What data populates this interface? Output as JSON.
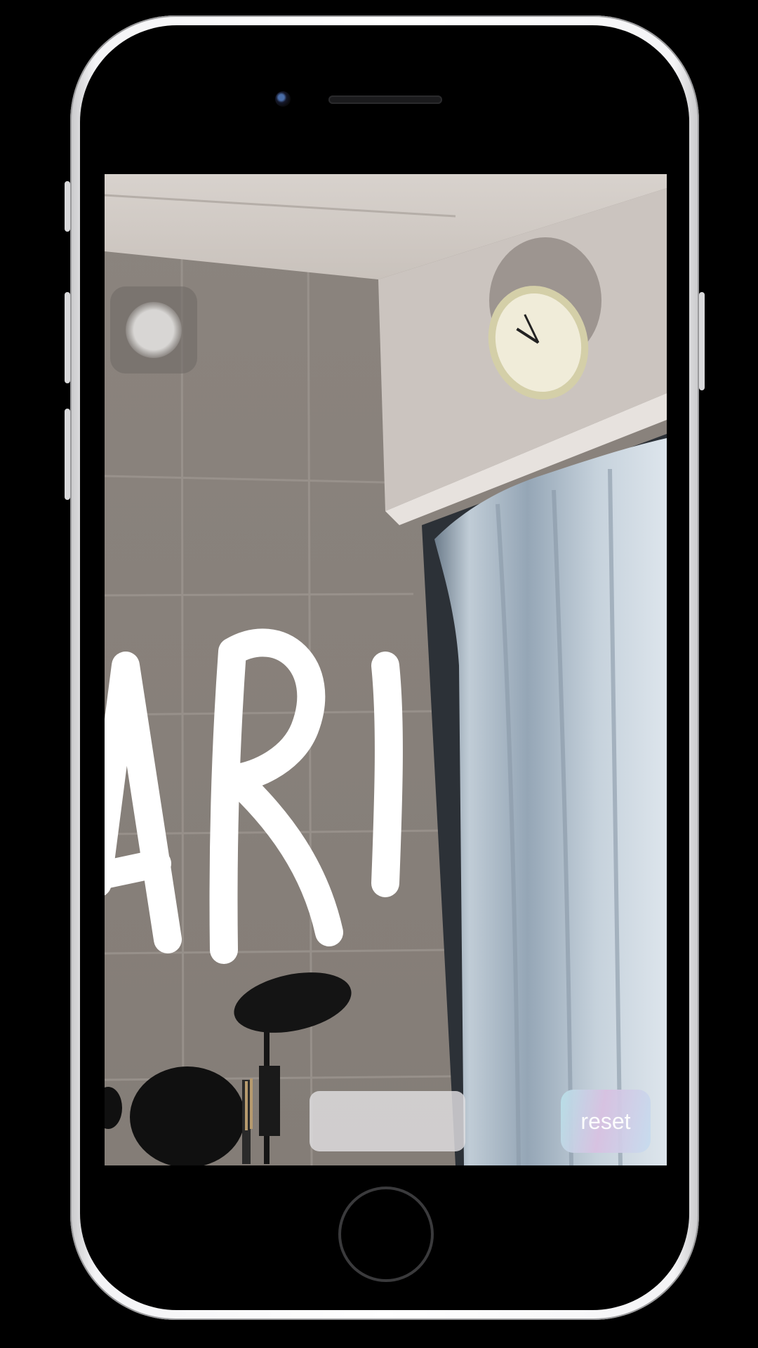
{
  "app": {
    "reset_label": "reset",
    "drawing_text": "ARI"
  },
  "icons": {
    "record": "record-circle-icon",
    "home": "home-button"
  },
  "colors": {
    "body": "#000000",
    "phone_frame": "#f4f4f6",
    "reset_gradient_start": "#b8e0e8",
    "reset_gradient_end": "#c7dcef",
    "stroke": "#ffffff"
  }
}
